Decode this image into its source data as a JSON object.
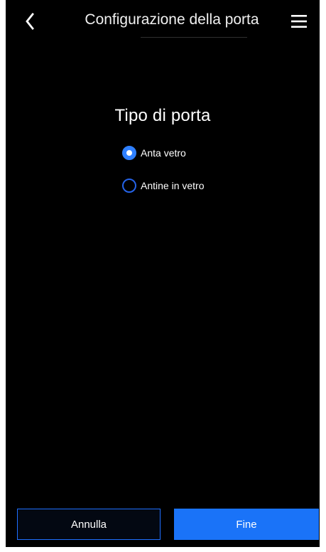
{
  "screen": {
    "title": "Configurazione della porta",
    "back_icon": "chevron-left-icon",
    "menu_icon": "hamburger-menu-icon"
  },
  "content": {
    "section_title": "Tipo di porta",
    "options": [
      {
        "label": "Anta vetro",
        "selected": true
      },
      {
        "label": "Antine in vetro",
        "selected": false
      }
    ]
  },
  "actions": {
    "cancel_label": "Annulla",
    "done_label": "Fine"
  },
  "colors": {
    "background": "#000000",
    "text": "#ffffff",
    "accent": "#1a73f8",
    "cancel_border": "#1f6fff"
  }
}
